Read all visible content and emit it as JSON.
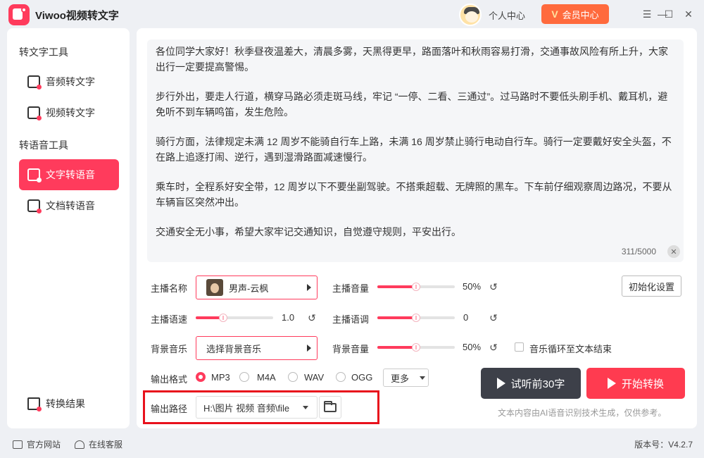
{
  "app": {
    "title": "Viwoo视频转文字"
  },
  "header": {
    "personal_center": "个人中心",
    "vip_label": "会员中心",
    "vip_badge": "V"
  },
  "window_controls": {
    "menu": "☰",
    "minimize": "—",
    "maximize": "☐",
    "close": "✕"
  },
  "sidebar": {
    "group1_title": "转文字工具",
    "group2_title": "转语音工具",
    "items": [
      {
        "label": "音频转文字"
      },
      {
        "label": "视频转文字"
      },
      {
        "label": "文字转语音"
      },
      {
        "label": "文档转语音"
      }
    ],
    "active_index": 2,
    "result_label": "转换结果"
  },
  "editor": {
    "paragraphs": [
      "各位同学大家好！秋季昼夜温差大，清晨多雾，天黑得更早，路面落叶和秋雨容易打滑，交通事故风险有所上升，大家出行一定要提高警惕。",
      "步行外出，要走人行道，横穿马路必须走斑马线，牢记 “一停、二看、三通过”。过马路时不要低头刷手机、戴耳机，避免听不到车辆鸣笛，发生危险。",
      "骑行方面，法律规定未满 12 周岁不能骑自行车上路，未满 16 周岁禁止骑行电动自行车。骑行一定要戴好安全头盔，不在路上追逐打闹、逆行，遇到湿滑路面减速慢行。",
      "乘车时，全程系好安全带，12 周岁以下不要坐副驾驶。不搭乘超载、无牌照的黑车。下车前仔细观察周边路况，不要从车辆盲区突然冲出。",
      "交通安全无小事，希望大家牢记交通知识，自觉遵守规则，平安出行。"
    ],
    "counter": "311/5000",
    "clear_symbol": "✕"
  },
  "settings": {
    "anchor_name_label": "主播名称",
    "anchor_name_value": "男声-云枫",
    "anchor_volume_label": "主播音量",
    "anchor_volume_value": "50%",
    "anchor_volume_level": 0.5,
    "init_button": "初始化设置",
    "speed_label": "主播语速",
    "speed_value": "1.0",
    "speed_level": 0.35,
    "pitch_label": "主播语调",
    "pitch_value": "0",
    "pitch_level": 0.5,
    "bgm_label": "背景音乐",
    "bgm_value": "选择背景音乐",
    "bgm_volume_label": "背景音量",
    "bgm_volume_value": "50%",
    "bgm_volume_level": 0.5,
    "loop_label": "音乐循环至文本结束",
    "format_label": "输出格式",
    "formats": [
      "MP3",
      "M4A",
      "WAV",
      "OGG"
    ],
    "format_selected": "MP3",
    "more_label": "更多",
    "path_label": "输出路径",
    "path_value": "H:\\图片 视频 音频\\file",
    "reset_symbol": "↺"
  },
  "actions": {
    "preview": "试听前30字",
    "start": "开始转换",
    "note": "文本内容由AI语音识别技术生成，仅供参考。"
  },
  "footer": {
    "website": "官方网站",
    "support": "在线客服",
    "version": "版本号：V4.2.7"
  },
  "colors": {
    "accent": "#ff3b5c",
    "dark_button": "#3d4049",
    "vip": "#ff6a3d",
    "highlight_frame": "#e8111c"
  }
}
